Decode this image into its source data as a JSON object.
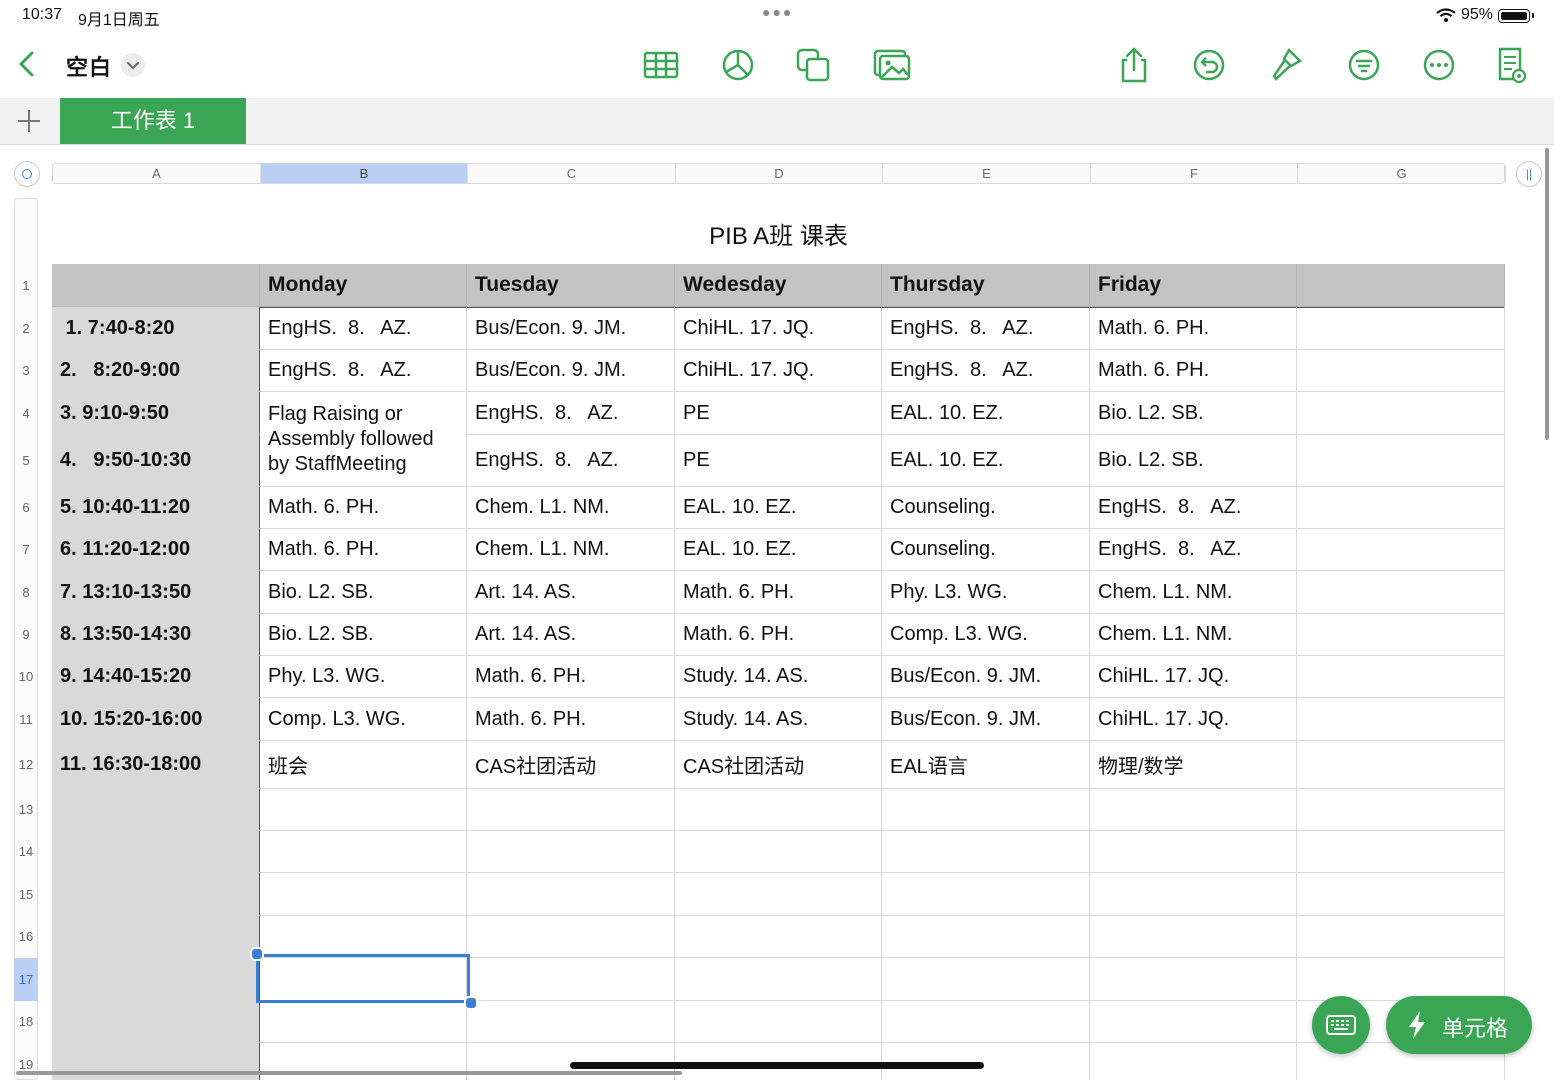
{
  "status": {
    "time": "10:37",
    "date": "9月1日周五",
    "battery": "95%"
  },
  "toolbar": {
    "title": "空白"
  },
  "sheet_tab": "工作表 1",
  "columns": [
    "A",
    "B",
    "C",
    "D",
    "E",
    "F",
    "G"
  ],
  "rows": [
    "1",
    "2",
    "3",
    "4",
    "5",
    "6",
    "7",
    "8",
    "9",
    "10",
    "11",
    "12",
    "13",
    "14",
    "15",
    "16",
    "17",
    "18",
    "19"
  ],
  "table": {
    "title": "PIB A班 课表",
    "header": [
      "",
      "Monday",
      "Tuesday",
      "Wedesday",
      "Thursday",
      "Friday",
      ""
    ],
    "body": [
      [
        " 1. 7:40-8:20",
        "EngHS.  8.   AZ.",
        "Bus/Econ. 9. JM.",
        "ChiHL. 17. JQ.",
        "EngHS.  8.   AZ.",
        "Math. 6. PH."
      ],
      [
        "2.   8:20-9:00",
        "EngHS.  8.   AZ.",
        "Bus/Econ. 9. JM.",
        "ChiHL. 17. JQ.",
        "EngHS.  8.   AZ.",
        "Math. 6. PH."
      ],
      [
        "3. 9:10-9:50",
        "Flag Raising or Assembly followed by StaffMeeting",
        "EngHS.  8.   AZ.",
        "PE",
        "EAL. 10. EZ.",
        "Bio. L2. SB."
      ],
      [
        "4.   9:50-10:30",
        "",
        "EngHS.  8.   AZ.",
        "PE",
        "EAL. 10. EZ.",
        "Bio. L2. SB."
      ],
      [
        "5. 10:40-11:20",
        "Math. 6. PH.",
        "Chem. L1. NM.",
        "EAL. 10. EZ.",
        "Counseling.",
        "EngHS.  8.   AZ."
      ],
      [
        "6. 11:20-12:00",
        "Math. 6. PH.",
        "Chem. L1. NM.",
        "EAL. 10. EZ.",
        "Counseling.",
        "EngHS.  8.   AZ."
      ],
      [
        "7. 13:10-13:50",
        "Bio. L2. SB.",
        "Art. 14. AS.",
        "Math. 6. PH.",
        "Phy. L3. WG.",
        "Chem. L1. NM."
      ],
      [
        "8. 13:50-14:30",
        "Bio. L2. SB.",
        "Art. 14. AS.",
        "Math. 6. PH.",
        "Comp. L3. WG.",
        "Chem. L1. NM."
      ],
      [
        "9. 14:40-15:20",
        "Phy. L3. WG.",
        "Math. 6. PH.",
        "Study. 14. AS.",
        "Bus/Econ. 9. JM.",
        "ChiHL. 17. JQ."
      ],
      [
        "10. 15:20-16:00",
        "Comp. L3. WG.",
        "Math. 6. PH.",
        "Study. 14. AS.",
        "Bus/Econ. 9. JM.",
        "ChiHL. 17. JQ."
      ],
      [
        "11. 16:30-18:00",
        "班会",
        "CAS社团活动",
        "CAS社团活动",
        "EAL语言",
        "物理/数学"
      ]
    ]
  },
  "selected": {
    "column": "B",
    "row": "17"
  },
  "fab": {
    "cell_label": "单元格"
  }
}
